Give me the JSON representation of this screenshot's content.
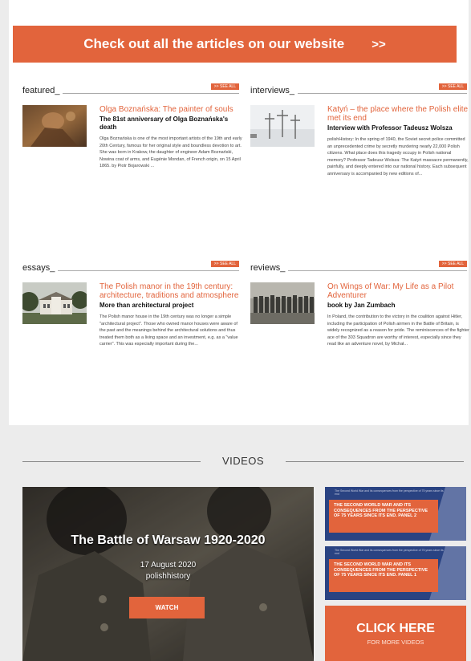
{
  "banner": {
    "text": "Check out all the articles on our website",
    "arrow": ">>"
  },
  "sections": {
    "featured": {
      "label": "featured_",
      "see_all": ">> SEE ALL",
      "title": "Olga Boznańska: The painter of souls",
      "subtitle": "The 81st anniversary of Olga Boznańska's death",
      "excerpt": "Olga Boznańska is one of the most important artists of the 19th and early 20th Century, famous for her original style and boundless devotion to art. She was born in Krakow, the daughter of engineer Adam Boznański, Nowina coat of arms, and Eugénie Mondan, of French origin, on 15 April 1865. by Piotr Bojarowski ..."
    },
    "interviews": {
      "label": "interviews_",
      "see_all": ">> SEE ALL",
      "title": "Katyń – the place where the Polish elite met its end",
      "subtitle": "Interview with Professor Tadeusz Wolsza",
      "excerpt": "polishHistory: In the spring of 1940, the Soviet secret police committed an unprecedented crime by secretly murdering nearly 22,000 Polish citizens. What place does this tragedy occupy in Polish national memory? Professor Tadeusz Wolsza: The Katyń massacre permanently, painfully, and deeply entered into our national history. Each subsequent anniversary is accompanied by new editions of..."
    },
    "essays": {
      "label": "essays_",
      "see_all": ">> SEE ALL",
      "title": "The Polish manor in the 19th century: architecture, traditions and atmosphere",
      "subtitle": "More than architectural project",
      "excerpt": "The Polish manor house in the 19th century was no longer a simple \"architectural project\". Those who owned manor houses were aware of the past and the meanings behind the architectural solutions and thus treated them both as a living space and an investment, e.g. as a \"value carrier\". This was especially important during the..."
    },
    "reviews": {
      "label": "reviews_",
      "see_all": ">> SEE ALL",
      "title": "On Wings of War: My Life as a Pilot Adventurer",
      "subtitle": "book by Jan Zumbach",
      "excerpt": "In Poland, the contribution to the victory in the coalition against Hitler, including the participation of Polish airmen in the Battle of Britain, is widely recognized as a reason for pride. The reminiscences of the fighter ace of the 303 Squadron are worthy of interest, especially since they read like an adventure novel, by Michał..."
    }
  },
  "videos": {
    "heading": "VIDEOS",
    "main": {
      "title": "The Battle of Warsaw 1920-2020",
      "date": "17 August 2020",
      "category": "polishhistory",
      "watch": "WATCH"
    },
    "side": [
      {
        "small": "The Second World War and its consequences from the perspective of 75 years since its end",
        "text": "THE SECOND WORLD WAR AND ITS CONSEQUENCES FROM THE PERSPECTIVE OF 75 YEARS SINCE ITS END. PANEL 2"
      },
      {
        "small": "The Second World War and its consequences from the perspective of 75 years since its end",
        "text": "THE SECOND WORLD WAR AND ITS CONSEQUENCES FROM THE PERSPECTIVE OF 75 YEARS SINCE ITS END. PANEL 1"
      }
    ],
    "click_here": {
      "main": "CLICK HERE",
      "sub": "FOR MORE VIDEOS"
    }
  },
  "colors": {
    "accent": "#e2643c",
    "panel_navy": "#2a4382"
  }
}
